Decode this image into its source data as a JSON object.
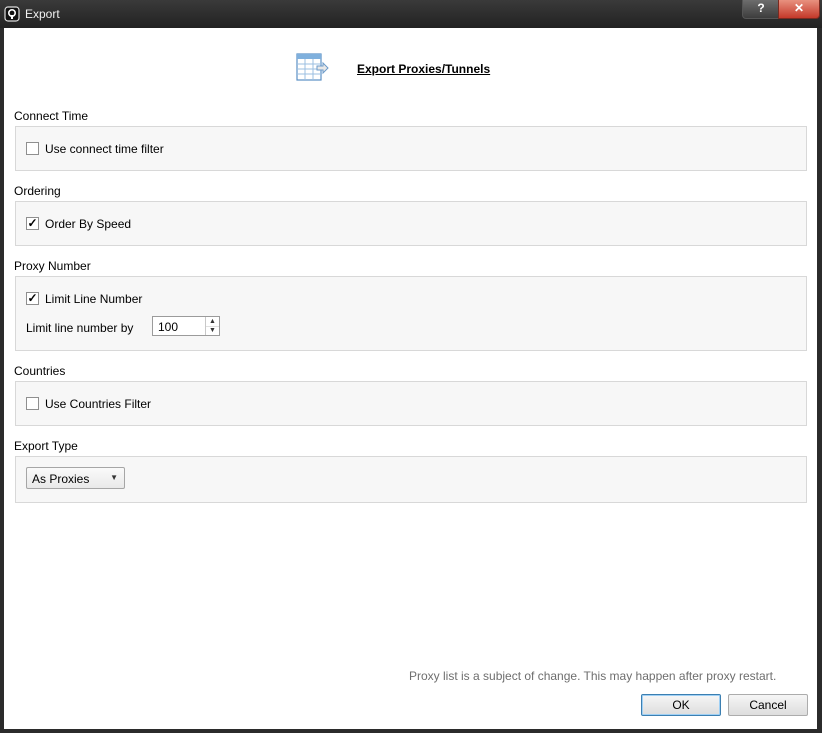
{
  "window": {
    "title": "Export",
    "help_label": "?",
    "close_label": "✕"
  },
  "header": {
    "title": "Export Proxies/Tunnels",
    "icon": "table-export-icon"
  },
  "connect_time": {
    "label": "Connect Time",
    "checkbox_label": "Use connect time filter",
    "checked": false
  },
  "ordering": {
    "label": "Ordering",
    "checkbox_label": "Order By Speed",
    "checked": true
  },
  "proxy_number": {
    "label": "Proxy Number",
    "checkbox_label": "Limit Line Number",
    "checked": true,
    "limit_label": "Limit line number by",
    "limit_value": "100"
  },
  "countries": {
    "label": "Countries",
    "checkbox_label": "Use Countries Filter",
    "checked": false
  },
  "export_type": {
    "label": "Export Type",
    "selected": "As Proxies"
  },
  "footer": {
    "note": "Proxy list is a subject of change. This may happen after proxy restart.",
    "ok_label": "OK",
    "cancel_label": "Cancel"
  },
  "glyphs": {
    "check": "✓",
    "up": "▲",
    "down": "▼"
  },
  "colors": {
    "titlebar": "#2b2b2b",
    "close_button": "#c4392a",
    "group_background": "#f7f7f7",
    "ok_border": "#3c7fb1"
  }
}
